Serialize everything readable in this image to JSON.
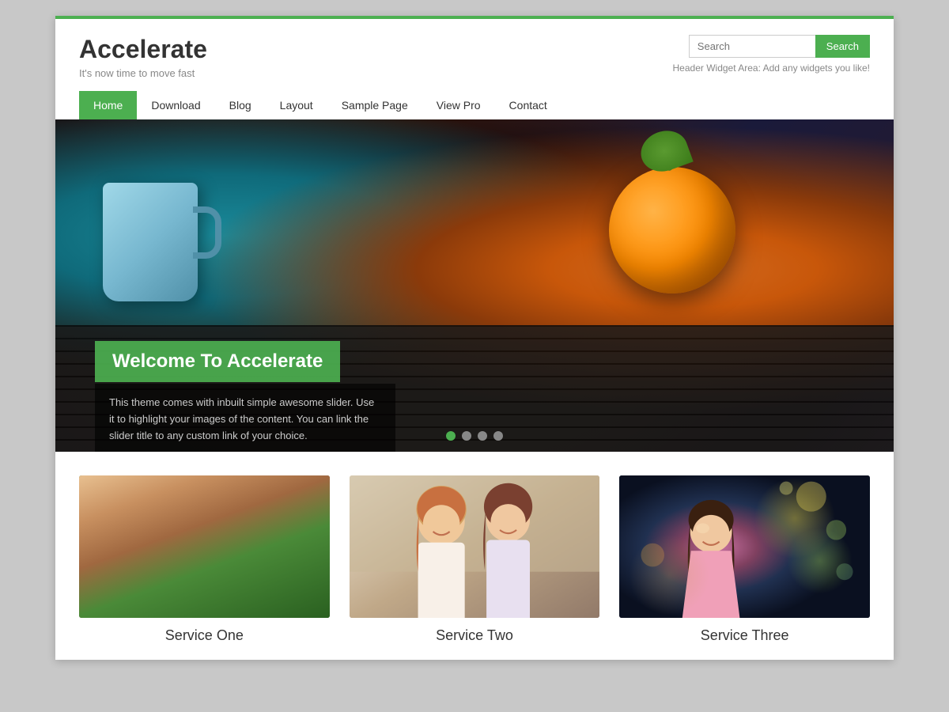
{
  "site": {
    "title": "Accelerate",
    "tagline": "It's now time to move fast",
    "top_line_color": "#4caf50"
  },
  "header": {
    "search_placeholder": "Search",
    "search_button_label": "Search",
    "widget_text": "Header Widget Area: Add any widgets you like!"
  },
  "nav": {
    "items": [
      {
        "label": "Home",
        "active": true
      },
      {
        "label": "Download",
        "active": false
      },
      {
        "label": "Blog",
        "active": false
      },
      {
        "label": "Layout",
        "active": false
      },
      {
        "label": "Sample Page",
        "active": false
      },
      {
        "label": "View Pro",
        "active": false
      },
      {
        "label": "Contact",
        "active": false
      }
    ]
  },
  "hero": {
    "title": "Welcome To Accelerate",
    "description": "This theme comes with inbuilt simple awesome slider. Use it to highlight your images of the content. You can link the slider title to any custom link of your choice.",
    "dots": [
      {
        "active": true
      },
      {
        "active": false
      },
      {
        "active": false
      },
      {
        "active": false
      }
    ]
  },
  "services": [
    {
      "title": "Service One"
    },
    {
      "title": "Service Two"
    },
    {
      "title": "Service Three"
    }
  ]
}
